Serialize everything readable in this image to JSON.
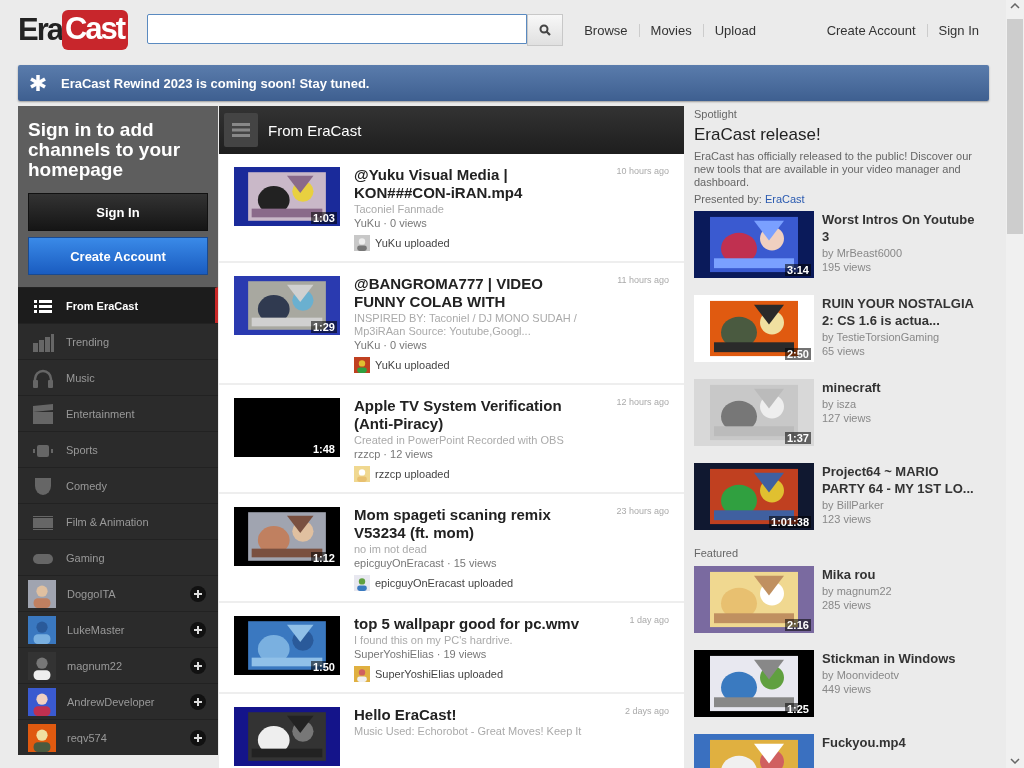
{
  "header": {
    "logo": {
      "part_1": "Era",
      "part_2": "Cast"
    },
    "nav": [
      "Browse",
      "Movies",
      "Upload"
    ],
    "account_links": [
      "Create Account",
      "Sign In"
    ]
  },
  "banner": {
    "text": "EraCast Rewind 2023 is coming soon! Stay tuned."
  },
  "sidebar": {
    "prompt": "Sign in to add channels to your homepage",
    "buttons": [
      {
        "label": "Sign In",
        "kind": "dark"
      },
      {
        "label": "Create Account",
        "kind": "primary"
      }
    ],
    "categories": [
      {
        "label": "From EraCast",
        "selected": true
      },
      {
        "label": "Trending",
        "selected": false
      },
      {
        "label": "Music",
        "selected": false
      },
      {
        "label": "Entertainment",
        "selected": false
      },
      {
        "label": "Sports",
        "selected": false
      },
      {
        "label": "Comedy",
        "selected": false
      },
      {
        "label": "Film & Animation",
        "selected": false
      },
      {
        "label": "Gaming",
        "selected": false
      }
    ],
    "channels": [
      {
        "name": "DoggoITA"
      },
      {
        "name": "LukeMaster"
      },
      {
        "name": "magnum22"
      },
      {
        "name": "AndrewDeveloper"
      },
      {
        "name": "reqv574"
      }
    ]
  },
  "feed": {
    "title": "From EraCast",
    "items": [
      {
        "title": "@Yuku Visual Media | KON###CON-iRAN.mp4",
        "description": "Taconiel Fanmade",
        "meta": "YuKu · 0 views",
        "uploader": "YuKu uploaded",
        "time": "10 hours ago",
        "duration": "1:03"
      },
      {
        "title": "@BANGROMA777 | VIDEO FUNNY COLAB WITH",
        "description": "INSPIRED BY: Taconiel / DJ MONO SUDAH / Mp3iRAan Source: Youtube,Googl...",
        "meta": "YuKu · 0 views",
        "uploader": "YuKu uploaded",
        "time": "11 hours ago",
        "duration": "1:29"
      },
      {
        "title": "Apple TV System Verification (Anti-Piracy)",
        "description": "Created in PowerPoint Recorded with OBS",
        "meta": "rzzcp · 12 views",
        "uploader": "rzzcp uploaded",
        "time": "12 hours ago",
        "duration": "1:48"
      },
      {
        "title": "Mom spageti scaning remix V53234 (ft. mom)",
        "description": "no im not dead",
        "meta": "epicguyOnEracast · 15 views",
        "uploader": "epicguyOnEracast uploaded",
        "time": "23 hours ago",
        "duration": "1:12"
      },
      {
        "title": "top 5 wallpapr good for pc.wmv",
        "description": "I found this on my PC's hardrive.",
        "meta": "SuperYoshiElias · 19 views",
        "uploader": "SuperYoshiElias uploaded",
        "time": "1 day ago",
        "duration": "1:50"
      },
      {
        "title": "Hello EraCast!",
        "description": "Music Used: Echorobot - Great Moves! Keep It",
        "time": "2 days ago"
      }
    ]
  },
  "spotlight": {
    "label": "Spotlight",
    "title": "EraCast release!",
    "description": "EraCast has officially released to the public! Discover our new tools that are available in your video manager and dashboard.",
    "presented_by": "Presented by:",
    "presenter": "EraCast",
    "videos": [
      {
        "title": "Worst Intros On Youtube 3",
        "author": "by MrBeast6000",
        "views": "195 views",
        "duration": "3:14"
      },
      {
        "title": "RUIN YOUR NOSTALGIA 2: CS 1.6 is actua...",
        "author": "by TestieTorsionGaming",
        "views": "65 views",
        "duration": "2:50"
      },
      {
        "title": "minecraft",
        "author": "by isza",
        "views": "127 views",
        "duration": "1:37"
      },
      {
        "title": "Project64 ~ MARIO PARTY 64 - MY 1ST LO...",
        "author": "by BillParker",
        "views": "123 views",
        "duration": "1:01:38"
      }
    ]
  },
  "featured": {
    "label": "Featured",
    "videos": [
      {
        "title": "Mika rou",
        "author": "by magnum22",
        "views": "285 views",
        "duration": "2:16"
      },
      {
        "title": "Stickman in Windows",
        "author": "by Moonvideotv",
        "views": "449 views",
        "duration": "1:25"
      },
      {
        "title": "Fuckyou.mp4"
      }
    ]
  }
}
